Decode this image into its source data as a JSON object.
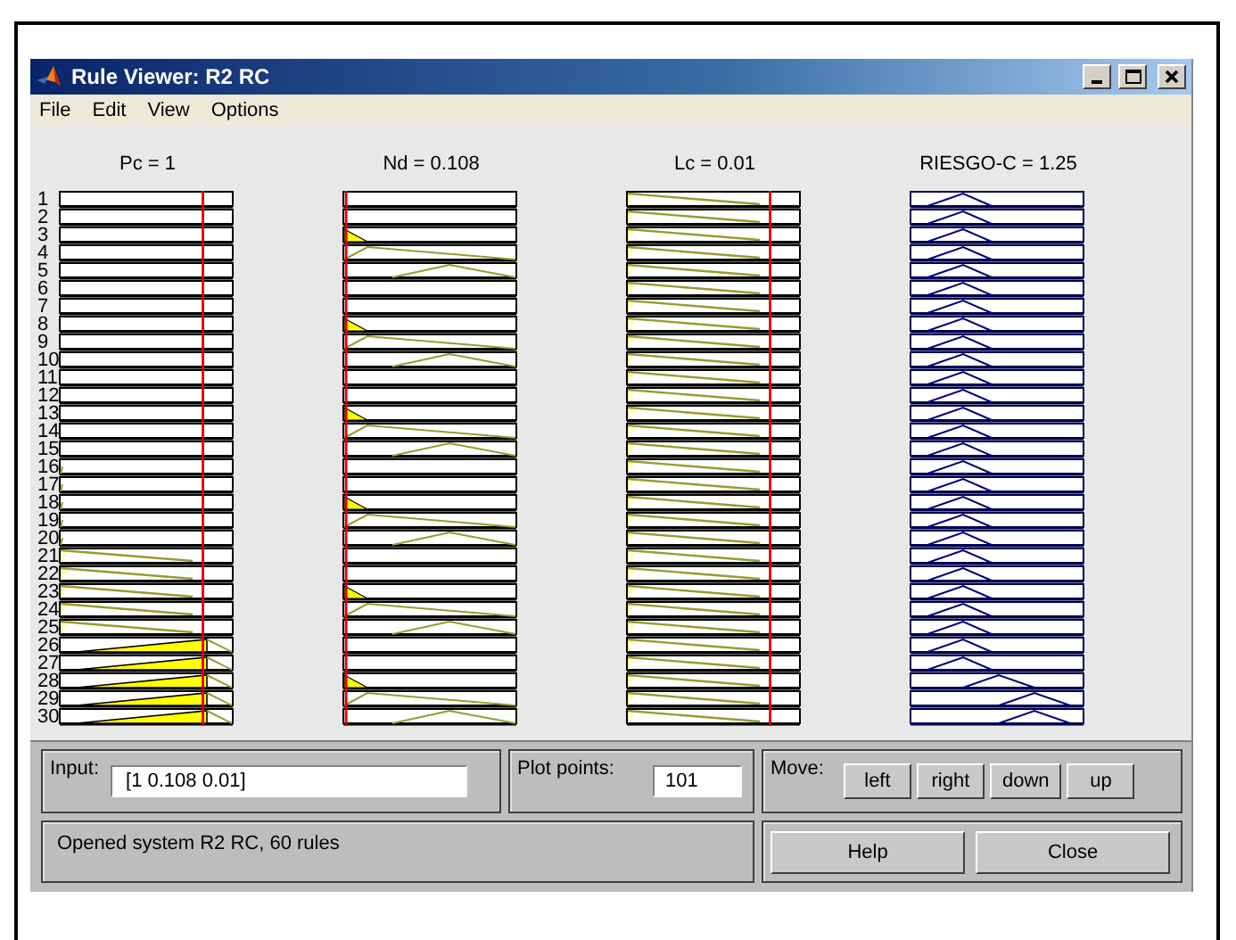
{
  "window": {
    "title": "Rule Viewer: R2 RC"
  },
  "menu": [
    "File",
    "Edit",
    "View",
    "Options"
  ],
  "rule_numbers": [
    "1",
    "2",
    "3",
    "4",
    "5",
    "6",
    "7",
    "8",
    "9",
    "10",
    "11",
    "12",
    "13",
    "14",
    "15",
    "16",
    "17",
    "18",
    "19",
    "20",
    "21",
    "22",
    "23",
    "24",
    "25",
    "26",
    "27",
    "28",
    "29",
    "30"
  ],
  "variables": [
    {
      "heading": "Pc = 1",
      "kind": "input",
      "rules": [
        {
          "kind": "empty"
        },
        {
          "kind": "empty"
        },
        {
          "kind": "empty"
        },
        {
          "kind": "empty"
        },
        {
          "kind": "empty"
        },
        {
          "kind": "empty"
        },
        {
          "kind": "empty"
        },
        {
          "kind": "empty"
        },
        {
          "kind": "empty"
        },
        {
          "kind": "empty"
        },
        {
          "kind": "empty"
        },
        {
          "kind": "empty"
        },
        {
          "kind": "empty"
        },
        {
          "kind": "empty"
        },
        {
          "kind": "empty"
        },
        {
          "kind": "sliver"
        },
        {
          "kind": "sliver"
        },
        {
          "kind": "sliver"
        },
        {
          "kind": "sliver"
        },
        {
          "kind": "sliver"
        },
        {
          "kind": "ramp"
        },
        {
          "kind": "ramp"
        },
        {
          "kind": "ramp"
        },
        {
          "kind": "ramp"
        },
        {
          "kind": "ramp"
        },
        {
          "kind": "rise"
        },
        {
          "kind": "rise"
        },
        {
          "kind": "rise"
        },
        {
          "kind": "rise"
        },
        {
          "kind": "rise"
        }
      ]
    },
    {
      "heading": "Nd = 0.108",
      "kind": "input",
      "rules": [
        {
          "kind": "empty"
        },
        {
          "kind": "empty"
        },
        {
          "kind": "corner"
        },
        {
          "kind": "low"
        },
        {
          "kind": "high"
        },
        {
          "kind": "empty"
        },
        {
          "kind": "empty"
        },
        {
          "kind": "corner"
        },
        {
          "kind": "low"
        },
        {
          "kind": "high"
        },
        {
          "kind": "empty"
        },
        {
          "kind": "empty"
        },
        {
          "kind": "corner"
        },
        {
          "kind": "low"
        },
        {
          "kind": "high"
        },
        {
          "kind": "empty"
        },
        {
          "kind": "empty"
        },
        {
          "kind": "corner"
        },
        {
          "kind": "low"
        },
        {
          "kind": "high"
        },
        {
          "kind": "empty"
        },
        {
          "kind": "empty"
        },
        {
          "kind": "corner"
        },
        {
          "kind": "low"
        },
        {
          "kind": "high"
        },
        {
          "kind": "empty"
        },
        {
          "kind": "empty"
        },
        {
          "kind": "corner"
        },
        {
          "kind": "low"
        },
        {
          "kind": "high"
        }
      ]
    },
    {
      "heading": "Lc = 0.01",
      "kind": "input",
      "rules": [
        {
          "kind": "ramp"
        },
        {
          "kind": "ramp"
        },
        {
          "kind": "ramp"
        },
        {
          "kind": "ramp"
        },
        {
          "kind": "ramp"
        },
        {
          "kind": "ramp"
        },
        {
          "kind": "ramp"
        },
        {
          "kind": "ramp"
        },
        {
          "kind": "ramp"
        },
        {
          "kind": "ramp"
        },
        {
          "kind": "ramp"
        },
        {
          "kind": "ramp"
        },
        {
          "kind": "ramp"
        },
        {
          "kind": "ramp"
        },
        {
          "kind": "ramp"
        },
        {
          "kind": "ramp"
        },
        {
          "kind": "ramp"
        },
        {
          "kind": "ramp"
        },
        {
          "kind": "ramp"
        },
        {
          "kind": "ramp"
        },
        {
          "kind": "ramp"
        },
        {
          "kind": "ramp"
        },
        {
          "kind": "ramp"
        },
        {
          "kind": "ramp"
        },
        {
          "kind": "ramp"
        },
        {
          "kind": "ramp"
        },
        {
          "kind": "ramp"
        },
        {
          "kind": "ramp"
        },
        {
          "kind": "ramp"
        },
        {
          "kind": "ramp"
        }
      ]
    },
    {
      "heading": "RIESGO-C = 1.25",
      "kind": "output",
      "rules": [
        {
          "kind": "peak-low"
        },
        {
          "kind": "peak-low"
        },
        {
          "kind": "peak-low"
        },
        {
          "kind": "peak-low"
        },
        {
          "kind": "peak-low"
        },
        {
          "kind": "peak-low"
        },
        {
          "kind": "peak-low"
        },
        {
          "kind": "peak-low"
        },
        {
          "kind": "peak-low"
        },
        {
          "kind": "peak-low"
        },
        {
          "kind": "peak-low"
        },
        {
          "kind": "peak-low"
        },
        {
          "kind": "peak-low"
        },
        {
          "kind": "peak-low"
        },
        {
          "kind": "peak-low"
        },
        {
          "kind": "peak-low"
        },
        {
          "kind": "peak-low"
        },
        {
          "kind": "peak-low"
        },
        {
          "kind": "peak-low"
        },
        {
          "kind": "peak-low"
        },
        {
          "kind": "peak-low"
        },
        {
          "kind": "peak-low"
        },
        {
          "kind": "peak-low"
        },
        {
          "kind": "peak-low"
        },
        {
          "kind": "peak-low"
        },
        {
          "kind": "peak-low"
        },
        {
          "kind": "peak-low"
        },
        {
          "kind": "peak-mid"
        },
        {
          "kind": "peak-high"
        },
        {
          "kind": "peak-high"
        }
      ]
    }
  ],
  "input": {
    "label": "Input:",
    "value": "[1 0.108 0.01]"
  },
  "plot_points": {
    "label": "Plot points:",
    "value": "101"
  },
  "move": {
    "label": "Move:",
    "buttons": [
      "left",
      "right",
      "down",
      "up"
    ]
  },
  "status": "Opened system R2 RC, 60 rules",
  "buttons": [
    "Help",
    "Close"
  ]
}
